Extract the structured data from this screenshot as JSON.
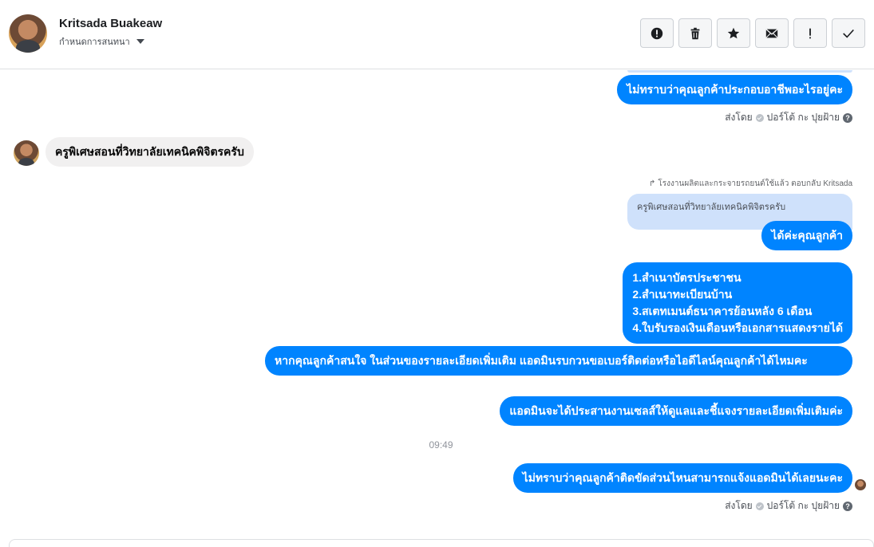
{
  "header": {
    "name": "Kritsada Buakeaw",
    "assign_label": "กำหนดการสนทนา",
    "toolbar": [
      {
        "icon": "alert-circle-icon"
      },
      {
        "icon": "trash-icon"
      },
      {
        "icon": "star-icon"
      },
      {
        "icon": "envelope-icon"
      },
      {
        "icon": "exclamation-icon"
      },
      {
        "icon": "checkmark-icon"
      }
    ]
  },
  "messages": {
    "m1": "ไม่ทราบว่าคุณลูกค้าประกอบอาชีพอะไรอยู่คะ",
    "sent_by_1": {
      "prefix": "ส่งโดย",
      "agent": "ปอร์โต้ กะ ปุยฝ้าย"
    },
    "in1": "ครูพิเศษสอนที่วิทยาลัยเทคนิคพิจิตรครับ",
    "reply_note": "โรงงานผลิตและกระจายรถยนต์ใช้แล้ว ตอบกลับ Kritsada",
    "quoted": "ครูพิเศษสอนที่วิทยาลัยเทคนิคพิจิตรครับ",
    "m2": "ได้ค่ะคุณลูกค้า",
    "m3_lines": [
      "1.สำเนาบัตรประชาชน",
      "2.สำเนาทะเบียนบ้าน",
      "3.สเตทเมนต์ธนาคารย้อนหลัง 6 เดือน",
      "4.ใบรับรองเงินเดือนหรือเอกสารแสดงรายได้"
    ],
    "m4": "หากคุณลูกค้าสนใจ ในส่วนของรายละเอียดเพิ่มเติม แอดมินรบกวนขอเบอร์ติดต่อหรือไอดีไลน์คุณลูกค้าได้ไหมคะ",
    "m5": "แอดมินจะได้ประสานงานเซลส์ให้ดูแลและชี้แจงรายละเอียดเพิ่มเติมค่ะ",
    "time": "09:49",
    "m6": "ไม่ทราบว่าคุณลูกค้าติดขัดส่วนไหนสามารถแจ้งแอดมินได้เลยนะคะ",
    "sent_by_2": {
      "prefix": "ส่งโดย",
      "agent": "ปอร์โต้ กะ ปุยฝ้าย"
    }
  },
  "colors": {
    "outgoing": "#0084ff",
    "incoming": "#f1f0f0",
    "quoted": "#cfe1fb"
  }
}
